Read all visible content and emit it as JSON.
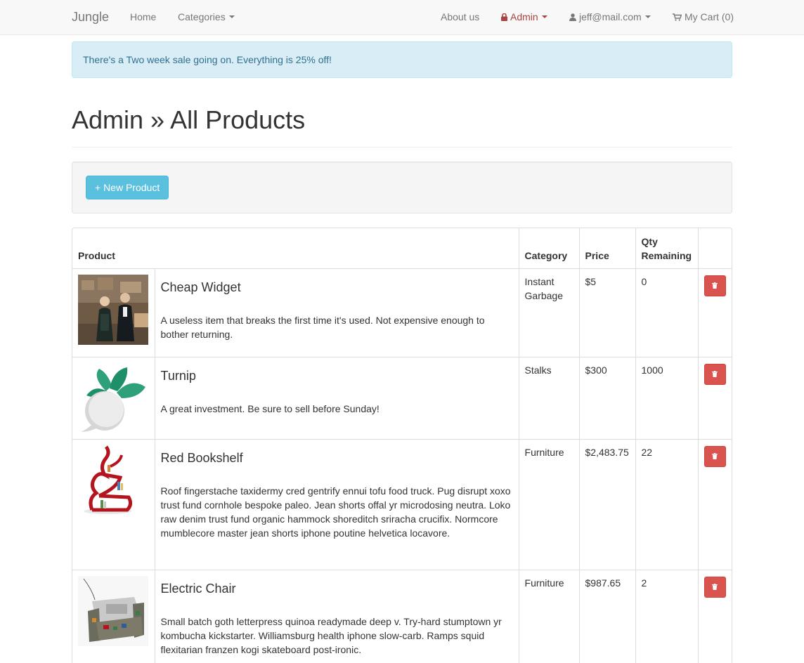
{
  "navbar": {
    "brand": "Jungle",
    "home": "Home",
    "categories": "Categories",
    "about": "About us",
    "admin": "Admin",
    "user": "jeff@mail.com",
    "cart": "My Cart (0)"
  },
  "alert": {
    "text": "There's a Two week sale going on. Everything is 25% off!"
  },
  "page": {
    "title": "Admin » All Products"
  },
  "toolbar": {
    "new_product": "+ New Product"
  },
  "table": {
    "headers": {
      "product": "Product",
      "category": "Category",
      "price": "Price",
      "qty": "Qty Remaining"
    },
    "rows": [
      {
        "name": "Cheap Widget",
        "description": "A useless item that breaks the first time it's used. Not expensive enough to bother returning.",
        "category": "Instant Garbage",
        "price": "$5",
        "qty": "0"
      },
      {
        "name": "Turnip",
        "description": "A great investment. Be sure to sell before Sunday!",
        "category": "Stalks",
        "price": "$300",
        "qty": "1000"
      },
      {
        "name": "Red Bookshelf",
        "description": "Roof fingerstache taxidermy cred gentrify ennui tofu food truck. Pug disrupt xoxo trust fund cornhole bespoke paleo. Jean shorts offal yr microdosing neutra. Loko raw denim trust fund organic hammock shoreditch sriracha crucifix. Normcore mumblecore master jean shorts iphone poutine helvetica locavore.",
        "category": "Furniture",
        "price": "$2,483.75",
        "qty": "22"
      },
      {
        "name": "Electric Chair",
        "description": "Small batch goth letterpress quinoa readymade deep v. Try-hard stumptown yr kombucha kickstarter. Williamsburg health iphone slow-carb. Ramps squid flexitarian franzen kogi skateboard post-ironic.",
        "category": "Furniture",
        "price": "$987.65",
        "qty": "2"
      }
    ]
  },
  "colors": {
    "info": "#5bc0de",
    "danger": "#d9534f",
    "alert_bg": "#d9edf7",
    "admin": "#a94442"
  },
  "icons": {
    "admin": "lock-icon",
    "user": "user-icon",
    "cart": "cart-icon",
    "delete": "trash-icon"
  }
}
